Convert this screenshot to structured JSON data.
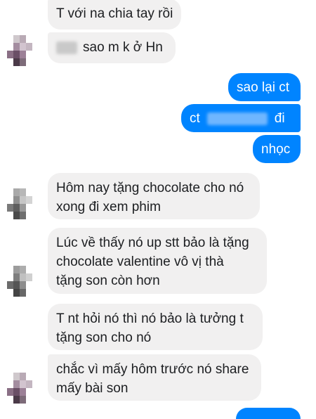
{
  "conversation": {
    "incoming": [
      {
        "text": "T với na chia tay rồi"
      },
      {
        "text": "sao m k ở Hn",
        "redacted_prefix": true
      },
      {
        "lines": [
          "Hôm nay tặng chocolate cho nó",
          "xong đi xem phim"
        ]
      },
      {
        "lines": [
          "Lúc về thấy nó up stt bảo là tặng",
          "chocolate valentine vô vị thà",
          "tặng son còn hơn"
        ]
      },
      {
        "lines": [
          "T nt hỏi nó thì nó bảo là tưởng t",
          "tặng son cho nó"
        ]
      },
      {
        "lines": [
          "chắc vì mấy hôm trước nó share",
          "mấy bài son"
        ]
      }
    ],
    "outgoing": [
      {
        "text": "sao lại ct"
      },
      {
        "prefix": "ct",
        "suffix": "đi",
        "redacted_middle": true
      },
      {
        "text": "nhọc"
      }
    ]
  },
  "colors": {
    "incoming_bg": "#f1f0f0",
    "outgoing_bg": "#0084ff",
    "outgoing_text": "#ffffff",
    "incoming_text": "#1c1e21"
  },
  "icons": [
    "pixelated-avatar"
  ]
}
